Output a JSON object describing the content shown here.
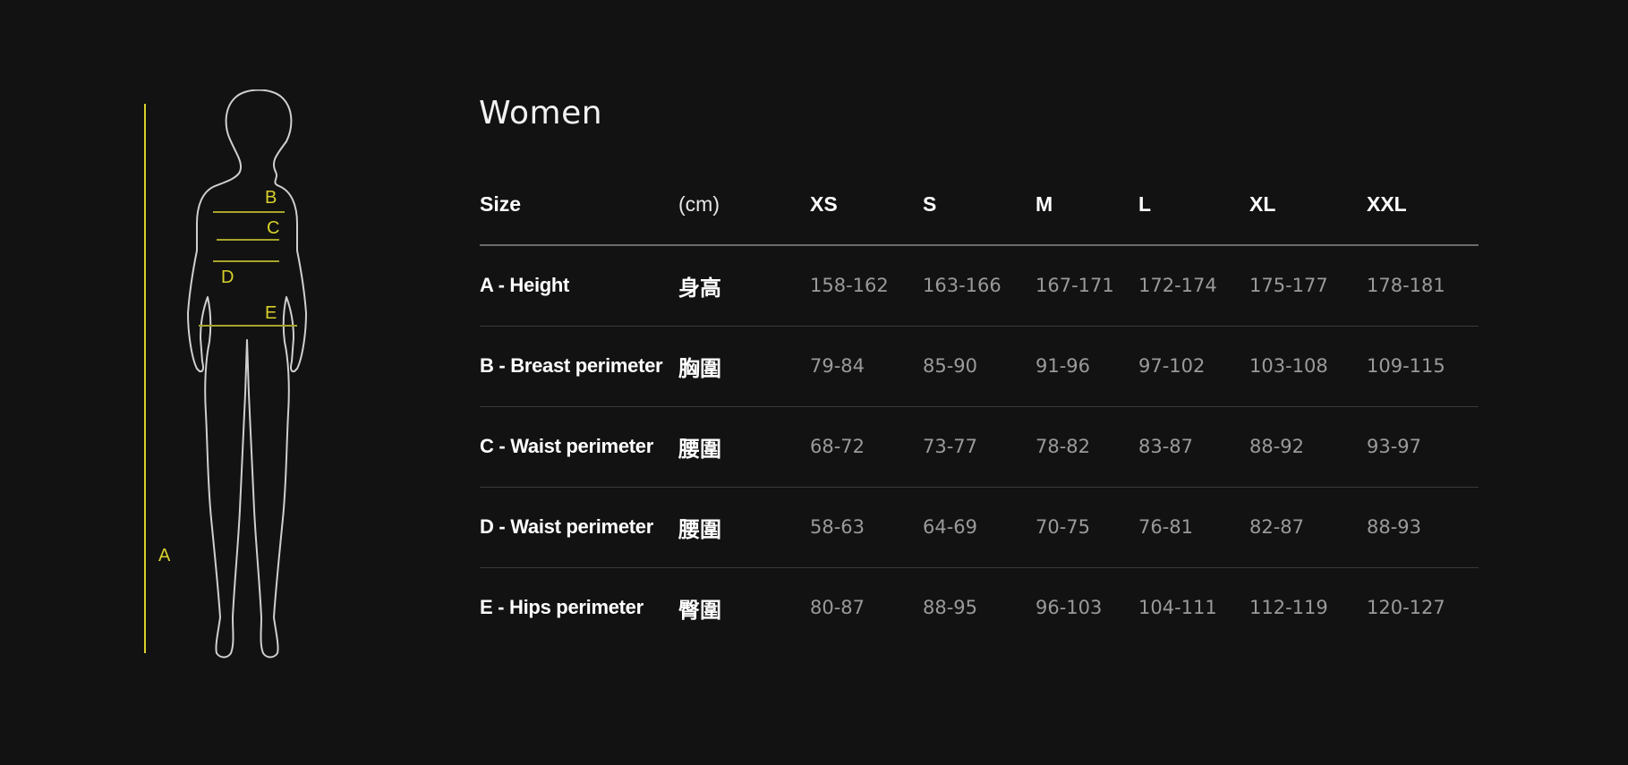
{
  "colors": {
    "background": "#121212",
    "accent": "#d8d12c",
    "silhouette": "#cfcfcf",
    "value_text": "#9a9a9a"
  },
  "figure": {
    "labels": [
      "A",
      "B",
      "C",
      "D",
      "E"
    ]
  },
  "title": "Women",
  "table": {
    "header": {
      "size_label": "Size",
      "unit_label": "(cm)",
      "sizes": [
        "XS",
        "S",
        "M",
        "L",
        "XL",
        "XXL"
      ]
    },
    "rows": [
      {
        "label": "A - Height",
        "label_zh": "身高",
        "values": [
          "158-162",
          "163-166",
          "167-171",
          "172-174",
          "175-177",
          "178-181"
        ]
      },
      {
        "label": "B - Breast perimeter",
        "label_zh": "胸圍",
        "values": [
          "79-84",
          "85-90",
          "91-96",
          "97-102",
          "103-108",
          "109-115"
        ]
      },
      {
        "label": "C - Waist perimeter",
        "label_zh": "腰圍",
        "values": [
          "68-72",
          "73-77",
          "78-82",
          "83-87",
          "88-92",
          "93-97"
        ]
      },
      {
        "label": "D - Waist perimeter",
        "label_zh": "腰圍",
        "values": [
          "58-63",
          "64-69",
          "70-75",
          "76-81",
          "82-87",
          "88-93"
        ]
      },
      {
        "label": "E - Hips perimeter",
        "label_zh": "臀圍",
        "values": [
          "80-87",
          "88-95",
          "96-103",
          "104-111",
          "112-119",
          "120-127"
        ]
      }
    ]
  }
}
